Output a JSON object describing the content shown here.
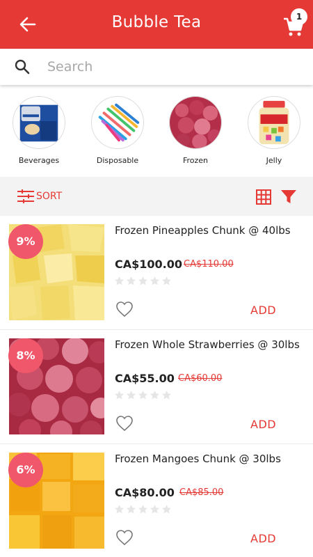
{
  "header": {
    "title": "Bubble Tea",
    "cart_count": "1",
    "bg_color": "#e53935"
  },
  "search": {
    "placeholder": "Search"
  },
  "categories": [
    {
      "label": "Beverages",
      "icon": "tea-box-image"
    },
    {
      "label": "Disposable",
      "icon": "straws-image"
    },
    {
      "label": "Frozen",
      "icon": "frozen-strawberries-image"
    },
    {
      "label": "Jelly",
      "icon": "rainbow-jelly-jar-image"
    }
  ],
  "toolbar": {
    "sort_label": "SORT",
    "accent": "#e53935"
  },
  "products": [
    {
      "name": "Frozen Pineapples Chunk @ 40lbs",
      "discount": "9%",
      "price": "CA$100.00",
      "old_price": "CA$110.00",
      "rating": 0,
      "add_label": "ADD"
    },
    {
      "name": "Frozen Whole Strawberries @ 30lbs",
      "discount": "8%",
      "price": "CA$55.00",
      "old_price": "CA$60.00",
      "rating": 0,
      "add_label": "ADD"
    },
    {
      "name": "Frozen Mangoes Chunk @ 30lbs",
      "discount": "6%",
      "price": "CA$80.00",
      "old_price": "CA$85.00",
      "rating": 0,
      "add_label": "ADD"
    }
  ]
}
